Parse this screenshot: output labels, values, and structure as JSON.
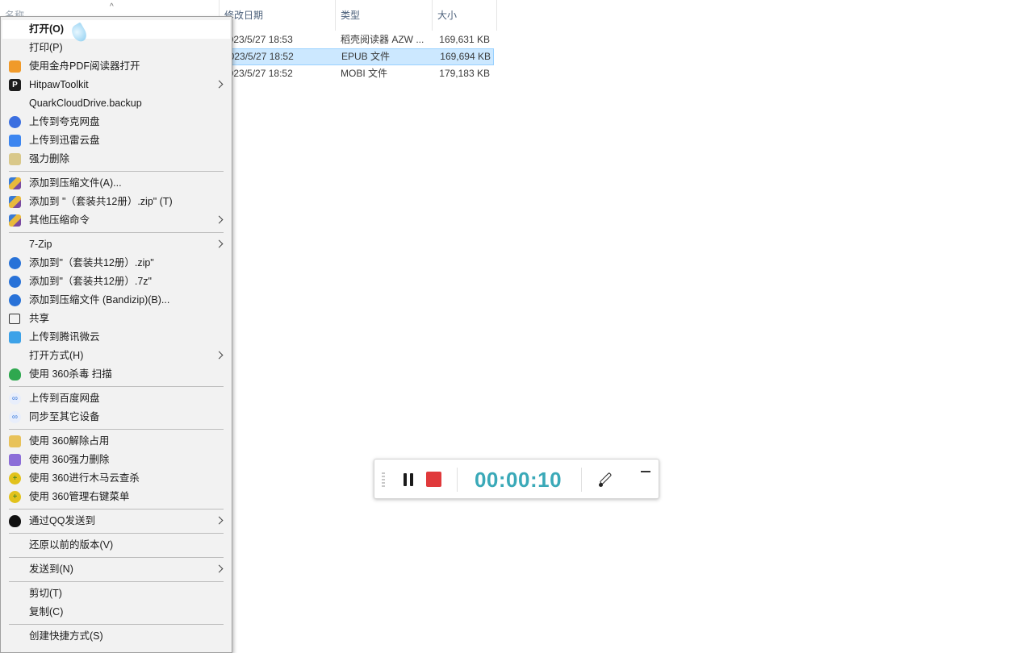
{
  "list_header": {
    "name": "名称",
    "date": "修改日期",
    "type": "类型",
    "size": "大小",
    "sort_arrow": "^"
  },
  "files": [
    {
      "date": "2023/5/27 18:53",
      "type": "稻壳阅读器 AZW ...",
      "size": "169,631 KB"
    },
    {
      "date": "2023/5/27 18:52",
      "type": "EPUB 文件",
      "size": "169,694 KB"
    },
    {
      "date": "2023/5/27 18:52",
      "type": "MOBI 文件",
      "size": "179,183 KB"
    }
  ],
  "context_menu": {
    "items": [
      {
        "label": "打开(O)"
      },
      {
        "label": "打印(P)"
      },
      {
        "label": "使用金舟PDF阅读器打开",
        "icon": "pdf-reader-icon"
      },
      {
        "label": "HitpawToolkit",
        "icon": "hitpaw-icon"
      },
      {
        "label": "QuarkCloudDrive.backup"
      },
      {
        "label": "上传到夸克网盘",
        "icon": "quark-cloud-icon"
      },
      {
        "label": "上传到迅雷云盘",
        "icon": "xunlei-cloud-icon"
      },
      {
        "label": "强力删除",
        "icon": "force-delete-icon"
      },
      {
        "label": "添加到压缩文件(A)...",
        "icon": "winrar-icon"
      },
      {
        "label": "添加到 \"（套装共12册）.zip\" (T)",
        "icon": "winrar-icon"
      },
      {
        "label": "其他压缩命令",
        "icon": "winrar-icon"
      },
      {
        "label": "7-Zip"
      },
      {
        "label": "添加到\"（套装共12册）.zip\"",
        "icon": "bandizip-icon"
      },
      {
        "label": "添加到\"（套装共12册）.7z\"",
        "icon": "bandizip-icon"
      },
      {
        "label": "添加到压缩文件 (Bandizip)(B)...",
        "icon": "bandizip-icon"
      },
      {
        "label": "共享",
        "icon": "share-icon"
      },
      {
        "label": "上传到腾讯微云",
        "icon": "weiyun-icon"
      },
      {
        "label": "打开方式(H)"
      },
      {
        "label": "使用 360杀毒 扫描",
        "icon": "360-antivirus-icon"
      },
      {
        "label": "上传到百度网盘",
        "icon": "baidu-netdisk-icon"
      },
      {
        "label": "同步至其它设备",
        "icon": "baidu-netdisk-icon"
      },
      {
        "label": "使用 360解除占用",
        "icon": "360-unlock-icon"
      },
      {
        "label": "使用 360强力删除",
        "icon": "360-force-delete-icon"
      },
      {
        "label": "使用 360进行木马云查杀",
        "icon": "360-trojan-icon"
      },
      {
        "label": "使用 360管理右键菜单",
        "icon": "360-trojan-icon"
      },
      {
        "label": "通过QQ发送到",
        "icon": "qq-icon"
      },
      {
        "label": "还原以前的版本(V)"
      },
      {
        "label": "发送到(N)"
      },
      {
        "label": "剪切(T)"
      },
      {
        "label": "复制(C)"
      },
      {
        "label": "创建快捷方式(S)"
      }
    ]
  },
  "recorder": {
    "timer": "00:00:10"
  }
}
